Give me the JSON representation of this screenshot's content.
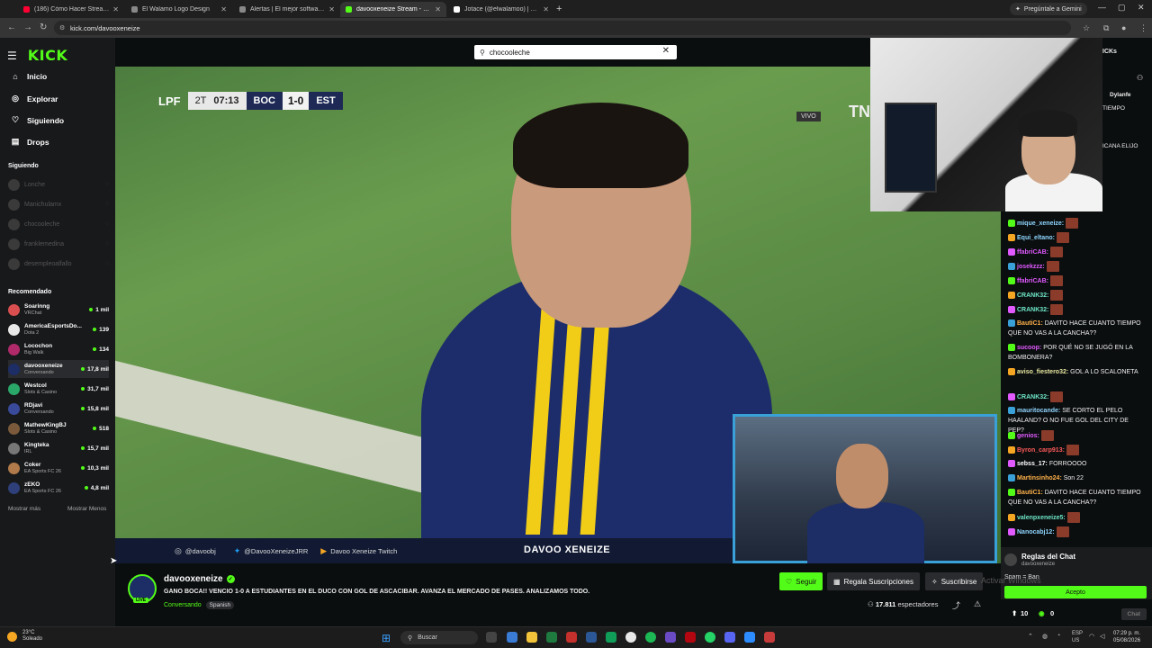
{
  "browser": {
    "tabs": [
      {
        "label": "(186) Cómo Hacer Streams en Y",
        "color": "#ff0033"
      },
      {
        "label": "El Walamo Logo Design",
        "color": "#888888"
      },
      {
        "label": "Alertas | El mejor software para",
        "color": "#888888"
      },
      {
        "label": "davooxeneize Stream - Wat",
        "color": "#53fc18",
        "active": true
      },
      {
        "label": "Jotace (@elwalamoo) | TikTok",
        "color": "#ffffff"
      }
    ],
    "gemini_label": "Pregúntale a Gemini",
    "url": "kick.com/davooxeneize"
  },
  "sidebar": {
    "logo": "KICK",
    "nav": [
      {
        "label": "Inicio",
        "icon": "home-icon"
      },
      {
        "label": "Explorar",
        "icon": "compass-icon"
      },
      {
        "label": "Siguiendo",
        "icon": "heart-icon"
      },
      {
        "label": "Drops",
        "icon": "gift-icon"
      }
    ],
    "following_title": "Siguiendo",
    "following": [
      "Lonche",
      "Manichulamx",
      "chocooleche",
      "franklemedina",
      "desempleoalfallo"
    ],
    "recommended_title": "Recomendado",
    "recommended": [
      {
        "name": "Soarinng",
        "category": "VRChat",
        "viewers": "1 mil",
        "color": "#d94f4f"
      },
      {
        "name": "AmericaEsportsDo...",
        "category": "Dota 2",
        "viewers": "139",
        "color": "#e8e8e8"
      },
      {
        "name": "Locochon",
        "category": "Big Walk",
        "viewers": "134",
        "color": "#b02a6a"
      },
      {
        "name": "davooxeneize",
        "category": "Conversando",
        "viewers": "17,8 mil",
        "color": "#1d2d66",
        "selected": true
      },
      {
        "name": "Westcol",
        "category": "Slots & Casino",
        "viewers": "31,7 mil",
        "color": "#2aa86a"
      },
      {
        "name": "RDjavi",
        "category": "Conversando",
        "viewers": "15,8 mil",
        "color": "#3a4a9a"
      },
      {
        "name": "MathewKingBJ",
        "category": "Slots & Casino",
        "viewers": "518",
        "color": "#7a5a3a"
      },
      {
        "name": "Kingteka",
        "category": "IRL",
        "viewers": "15,7 mil",
        "color": "#777777"
      },
      {
        "name": "Coker",
        "category": "EA Sports FC 26",
        "viewers": "10,3 mil",
        "color": "#b07a4a"
      },
      {
        "name": "zEKO",
        "category": "EA Sports FC 26",
        "viewers": "4,8 mil",
        "color": "#2f3f7a"
      }
    ],
    "show_more": "Mostrar más",
    "show_less": "Mostrar Menos"
  },
  "search": {
    "value": "chocooleche"
  },
  "video": {
    "scorebug": {
      "league": "LPF",
      "half": "2T",
      "clock": "07:13",
      "home": "BOC",
      "score": "1-0",
      "away": "EST"
    },
    "vivo": "VIVO",
    "tn": "TN",
    "socials": [
      {
        "icon": "instagram-icon",
        "label": "@davoobj"
      },
      {
        "icon": "twitter-icon",
        "label": "@DavooXeneizeJRR"
      },
      {
        "icon": "youtube-icon",
        "label": "Davoo Xeneize Twitch"
      }
    ],
    "overlay_title": "DAVOO XENEIZE"
  },
  "top_right": {
    "name_tag": "Dylanfe",
    "msg1": "TIEMPO",
    "msg2": "ICANA ELIJO",
    "kicks": "ICKs"
  },
  "chat": {
    "messages": [
      {
        "user": "mique_xeneize:",
        "color": "#8fd6ff",
        "text": "",
        "emote": true
      },
      {
        "user": "Equi_eltano:",
        "color": "#8fd6ff",
        "text": "",
        "emote": true
      },
      {
        "user": "ffabriCAB:",
        "color": "#e05aff",
        "text": "",
        "emote": true
      },
      {
        "user": "josekzzz:",
        "color": "#e05aff",
        "text": "",
        "emote": true
      },
      {
        "user": "ffabriCAB:",
        "color": "#e05aff",
        "text": "",
        "emote": true
      },
      {
        "user": "CRANK32:",
        "color": "#6ee8c9",
        "text": "",
        "emote": true
      },
      {
        "user": "CRANK32:",
        "color": "#6ee8c9",
        "text": "",
        "emote": true
      },
      {
        "user": "BautiC1:",
        "color": "#ffb24a",
        "text": "DAVITO HACE CUANTO TIEMPO QUE NO VAS A LA CANCHA??"
      },
      {
        "user": "sucoop:",
        "color": "#e05aff",
        "text": "POR QUÉ NO SE JUGÓ EN LA BOMBONERA?"
      },
      {
        "user": "aviso_fiestero32:",
        "color": "#e8e8a0",
        "text": "GOL A LO SCALONETA"
      },
      {
        "user": "CRANK32:",
        "color": "#6ee8c9",
        "text": "",
        "emote": true
      },
      {
        "user": "mauritocande:",
        "color": "#8fd6ff",
        "text": "SE CORTO EL PELO HAALAND? O NO FUE GOL DEL CITY DE PEP?"
      },
      {
        "user": "genios:",
        "color": "#e05aff",
        "text": "",
        "emote": true
      },
      {
        "user": "Byron_carp913:",
        "color": "#ff5a5a",
        "text": "",
        "emote": true
      },
      {
        "user": "sebss_17:",
        "color": "#ffffff",
        "text": "FORROOOO"
      },
      {
        "user": "Martinsinho24:",
        "color": "#ffb24a",
        "text": "Son 22"
      },
      {
        "user": "BautiC1:",
        "color": "#ffb24a",
        "text": "DAVITO HACE CUANTO TIEMPO QUE NO VAS A LA CANCHA??"
      },
      {
        "user": "valenpxeneize5:",
        "color": "#6ee8c9",
        "text": "",
        "emote": true
      },
      {
        "user": "Nanocabj12:",
        "color": "#8fd6ff",
        "text": "",
        "emote": true
      }
    ],
    "rules_title": "Reglas del Chat",
    "rules_sub": "davooxeneize",
    "rules_line": "Spam = Ban",
    "accept": "Acepto",
    "kicks_count": "10",
    "points_count": "0",
    "chat_button": "Chat"
  },
  "stream": {
    "name": "davooxeneize",
    "title": "GANO BOCA!! VENCIO 1-0 A ESTUDIANTES EN EL DUCO CON GOL DE ASCACIBAR. AVANZA EL MERCADO DE PASES. ANALIZAMOS TODO.",
    "category": "Conversando",
    "language": "Spanish",
    "live": "LIVE",
    "follow": "Seguir",
    "gift": "Regala Suscripciones",
    "subscribe": "Suscribirse",
    "viewers": "17.811",
    "viewers_label": "espectadores"
  },
  "watermark": "Activar Windows",
  "taskbar": {
    "temp": "23°C",
    "weather": "Soleado",
    "search": "Buscar",
    "lang": "ESP",
    "region": "US",
    "time": "07:29 p. m.",
    "date": "05/08/2026"
  }
}
